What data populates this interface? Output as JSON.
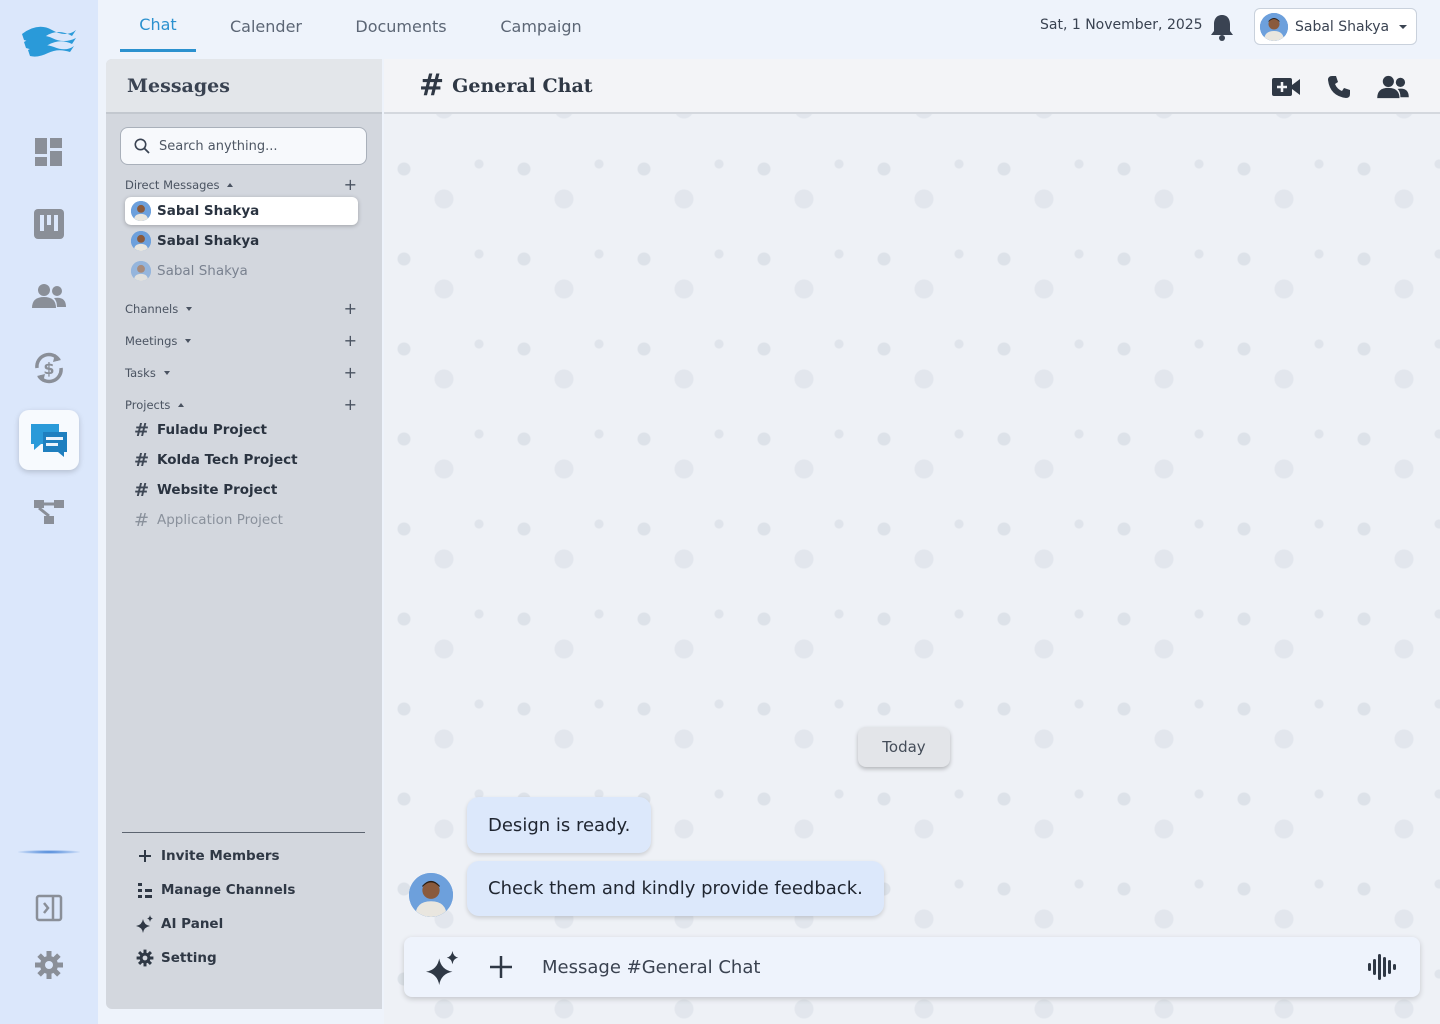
{
  "topbar": {
    "tabs": [
      {
        "label": "Chat"
      },
      {
        "label": "Calender"
      },
      {
        "label": "Documents"
      },
      {
        "label": "Campaign"
      }
    ],
    "date": "Sat, 1 November,  2025",
    "user_name": "Sabal Shakya"
  },
  "sidebar": {
    "title": "Messages",
    "search_placeholder": "Search anything...",
    "sections": {
      "direct_messages": "Direct Messages",
      "channels": "Channels",
      "meetings": "Meetings",
      "tasks": "Tasks",
      "projects": "Projects"
    },
    "direct_messages": [
      {
        "name": "Sabal Shakya"
      },
      {
        "name": "Sabal Shakya"
      },
      {
        "name": "Sabal Shakya"
      }
    ],
    "projects": [
      {
        "name": "Fuladu Project"
      },
      {
        "name": "Kolda Tech Project"
      },
      {
        "name": "Website Project"
      },
      {
        "name": "Application Project"
      }
    ],
    "actions": [
      {
        "label": "Invite Members",
        "icon": "plus-icon"
      },
      {
        "label": "Manage Channels",
        "icon": "channels-tree-icon"
      },
      {
        "label": "AI Panel",
        "icon": "sparkle-icon"
      },
      {
        "label": "Setting",
        "icon": "gear-icon"
      }
    ]
  },
  "chat": {
    "hash": "#",
    "title": "General Chat",
    "day_divider": "Today",
    "messages": [
      {
        "text": "Design is ready."
      },
      {
        "text": "Check them and kindly provide feedback."
      }
    ],
    "composer_placeholder": "Message #General Chat"
  },
  "colors": {
    "accent": "#2b91cf",
    "rail_bg": "#dbe7fb",
    "sidebar_bg": "#d3d7de",
    "bubble_bg": "#dce8fb"
  }
}
